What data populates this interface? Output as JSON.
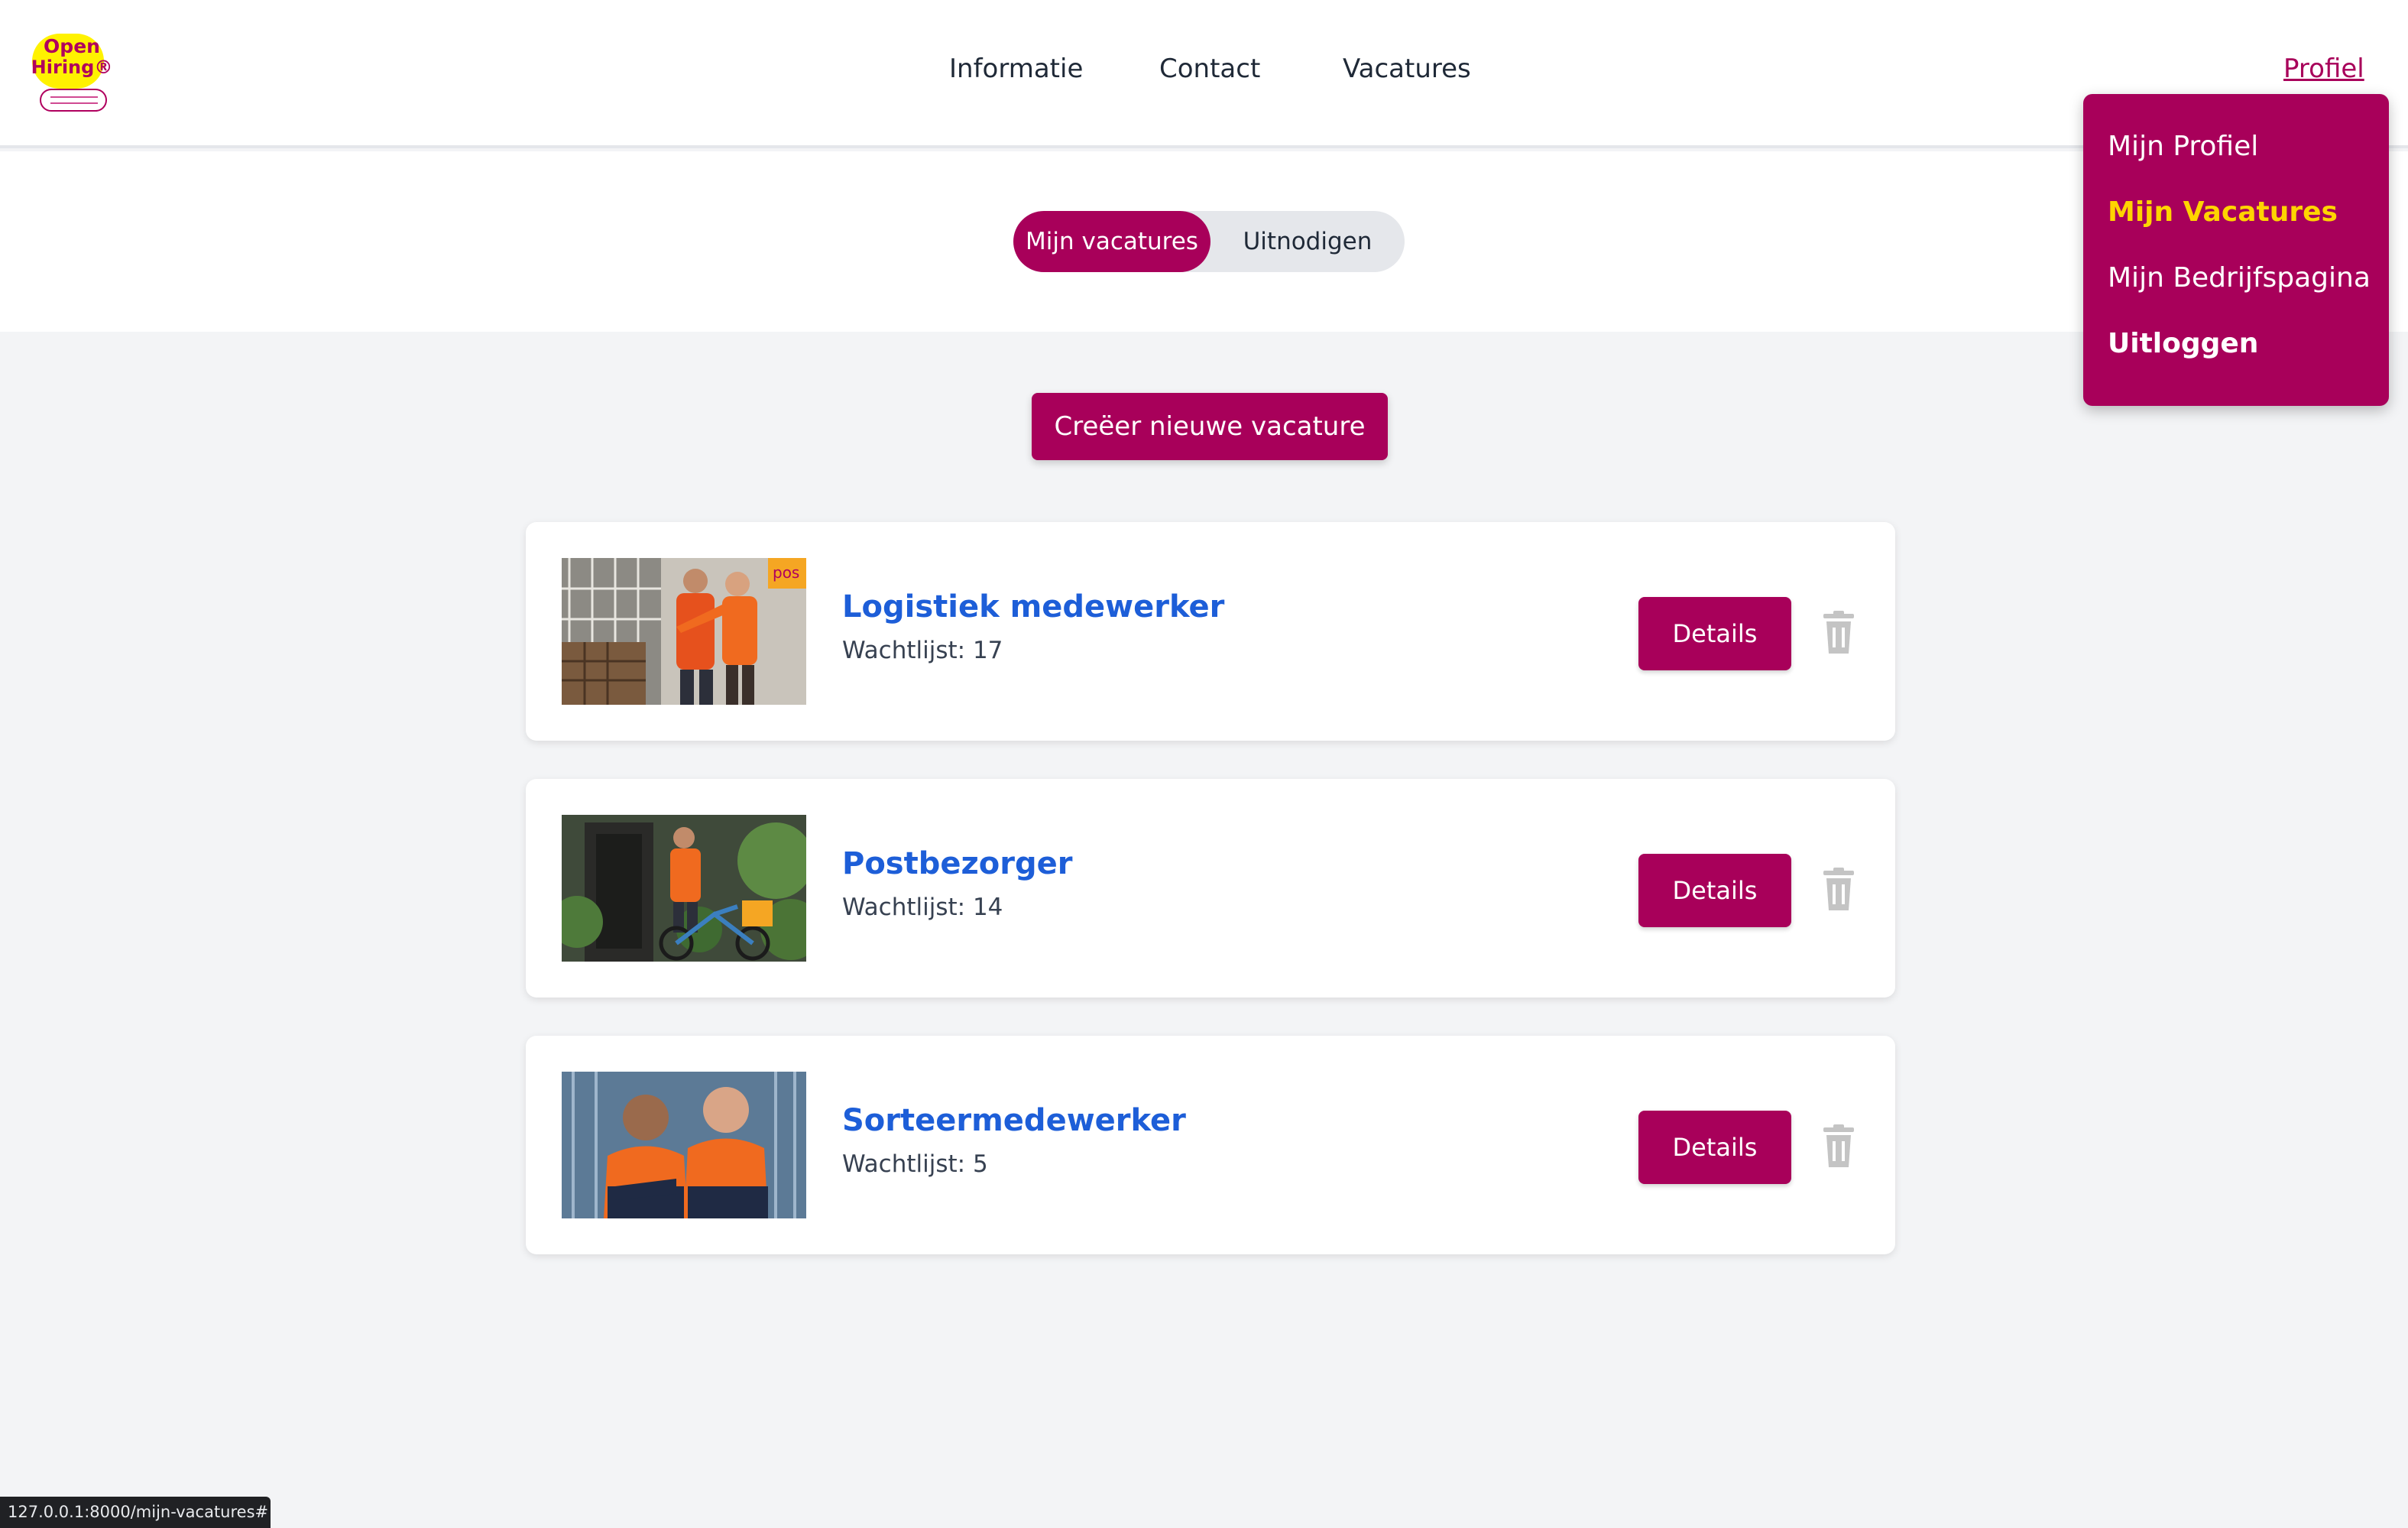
{
  "brand": {
    "logo_line1": "Open",
    "logo_line2": "Hiring®",
    "logo_tagline": "een baan zonder sollicitatiegesprek",
    "accent_color": "#a8005a",
    "highlight_color": "#ffd400",
    "title_color": "#1d5ed8"
  },
  "nav": {
    "items": [
      "Informatie",
      "Contact",
      "Vacatures"
    ],
    "profile": "Profiel"
  },
  "profile_menu": {
    "items": [
      "Mijn Profiel",
      "Mijn Vacatures",
      "Mijn Bedrijfspagina",
      "Uitloggen"
    ],
    "active": "Mijn Vacatures"
  },
  "tabs": {
    "active": "Mijn vacatures",
    "other": "Uitnodigen"
  },
  "create_button": "Creëer nieuwe vacature",
  "vacancies": [
    {
      "title": "Logistiek medewerker",
      "waitlist": "Wachtlijst: 17",
      "details": "Details",
      "image_sign": "pos"
    },
    {
      "title": "Postbezorger",
      "waitlist": "Wachtlijst: 14",
      "details": "Details"
    },
    {
      "title": "Sorteermedewerker",
      "waitlist": "Wachtlijst: 5",
      "details": "Details"
    }
  ],
  "icons": {
    "delete": "trash-icon"
  },
  "status_bar": {
    "url": "127.0.0.1:8000/mijn-vacatures#"
  }
}
